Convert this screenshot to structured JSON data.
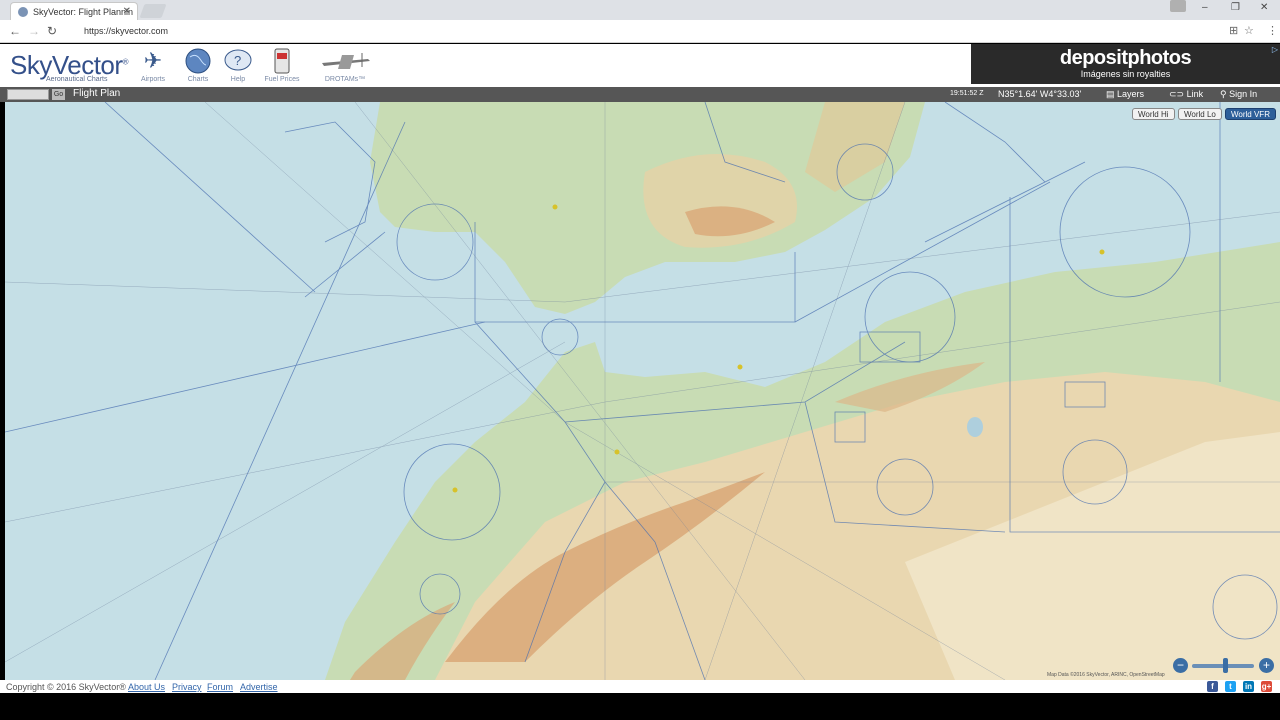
{
  "browser": {
    "tab_title": "SkyVector: Flight Plannin",
    "url": "https://skyvector.com"
  },
  "header": {
    "logo": "SkyVector",
    "logo_tm": "®",
    "logo_sub": "Aeronautical Charts",
    "nav": [
      {
        "label": "Airports",
        "icon": "airplane-icon"
      },
      {
        "label": "Charts",
        "icon": "globe-icon"
      },
      {
        "label": "Help",
        "icon": "help-icon"
      },
      {
        "label": "Fuel Prices",
        "icon": "fuel-pump-icon"
      },
      {
        "label": "DROTAMs™",
        "icon": "drone-icon"
      }
    ],
    "ad": {
      "brand": "depositphotos",
      "tagline": "Imágenes sin royalties"
    }
  },
  "toolbar": {
    "go": "Go",
    "flight_plan": "Flight Plan",
    "time": "19:51:52 Z",
    "coords": "N35°1.64' W4°33.03'",
    "layers": "Layers",
    "link": "Link",
    "sign_in": "Sign In"
  },
  "map": {
    "chart_buttons": [
      "World Hi",
      "World Lo",
      "World VFR"
    ],
    "active_chart": "World VFR",
    "attribution": "Map Data ©2016 SkyVector, ARINC, OpenStreetMap",
    "colors": {
      "sea": "#c5dfe6",
      "lowland": "#c8dcb4",
      "plateau": "#e9d7b0",
      "mountain": "#d9a878",
      "airspace": "#4a6fb0"
    }
  },
  "footer": {
    "copyright": "Copyright © 2016 SkyVector®",
    "links": [
      "About Us",
      "Privacy",
      "Forum",
      "Advertise"
    ],
    "social": [
      "facebook-icon",
      "twitter-icon",
      "linkedin-icon",
      "google-plus-icon"
    ]
  }
}
